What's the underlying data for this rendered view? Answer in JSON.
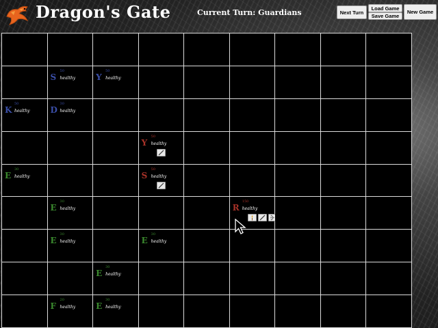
{
  "header": {
    "title": "Dragon's Gate",
    "turn_text": "Current Turn: Guardians",
    "logo_icon": "dragon-logo-icon"
  },
  "buttons": {
    "next_turn": "Next Turn",
    "load_game": "Load Game",
    "save_game": "Save Game",
    "new_game": "New Game"
  },
  "colors": {
    "blue_team": "#3b4fa8",
    "red_team": "#a83228",
    "green_team": "#3b8a2e"
  },
  "board": {
    "cols": 9,
    "rows": 9,
    "units": [
      {
        "row": 1,
        "col": 1,
        "letter": "S",
        "hp": "50",
        "status": "healthy",
        "team": "blue",
        "items": []
      },
      {
        "row": 1,
        "col": 2,
        "letter": "Y",
        "hp": "50",
        "status": "healthy",
        "team": "blue",
        "items": []
      },
      {
        "row": 2,
        "col": 0,
        "letter": "K",
        "hp": "50",
        "status": "healthy",
        "team": "blue",
        "items": []
      },
      {
        "row": 2,
        "col": 1,
        "letter": "D",
        "hp": "30",
        "status": "healthy",
        "team": "blue",
        "items": []
      },
      {
        "row": 3,
        "col": 3,
        "letter": "Y",
        "hp": "50",
        "status": "healthy",
        "team": "red",
        "items": [
          "sword-icon"
        ]
      },
      {
        "row": 4,
        "col": 0,
        "letter": "E",
        "hp": "30",
        "status": "healthy",
        "team": "green",
        "items": []
      },
      {
        "row": 4,
        "col": 3,
        "letter": "S",
        "hp": "50",
        "status": "healthy",
        "team": "red",
        "items": [
          "sword-icon"
        ]
      },
      {
        "row": 5,
        "col": 1,
        "letter": "E",
        "hp": "30",
        "status": "healthy",
        "team": "green",
        "items": []
      },
      {
        "row": 5,
        "col": 5,
        "letter": "R",
        "hp": "150",
        "status": "healthy",
        "team": "red",
        "items": [
          "torch-icon",
          "sword-icon",
          "bow-icon"
        ]
      },
      {
        "row": 6,
        "col": 1,
        "letter": "E",
        "hp": "30",
        "status": "healthy",
        "team": "green",
        "items": []
      },
      {
        "row": 6,
        "col": 3,
        "letter": "E",
        "hp": "30",
        "status": "healthy",
        "team": "green",
        "items": []
      },
      {
        "row": 7,
        "col": 2,
        "letter": "E",
        "hp": "30",
        "status": "healthy",
        "team": "green",
        "items": []
      },
      {
        "row": 8,
        "col": 1,
        "letter": "F",
        "hp": "20",
        "status": "healthy",
        "team": "green",
        "items": []
      },
      {
        "row": 8,
        "col": 2,
        "letter": "E",
        "hp": "30",
        "status": "healthy",
        "team": "green",
        "items": []
      }
    ]
  }
}
